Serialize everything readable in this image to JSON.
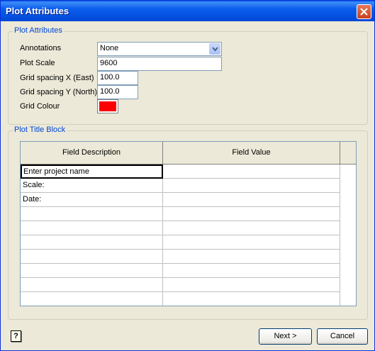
{
  "window": {
    "title": "Plot Attributes"
  },
  "attributes": {
    "group_label": "Plot Attributes",
    "annotations_label": "Annotations",
    "annotations_value": "None",
    "plot_scale_label": "Plot Scale",
    "plot_scale_value": "9600",
    "grid_x_label": "Grid spacing X (East)",
    "grid_x_value": "100.0",
    "grid_y_label": "Grid spacing Y (North)",
    "grid_y_value": "100.0",
    "grid_colour_label": "Grid Colour",
    "grid_colour": "#FF0000"
  },
  "title_block": {
    "group_label": "Plot Title Block",
    "columns": [
      "Field Description",
      "Field Value"
    ],
    "rows": [
      [
        "Enter project name",
        ""
      ],
      [
        "Scale:",
        ""
      ],
      [
        "Date:",
        ""
      ],
      [
        "",
        ""
      ],
      [
        "",
        ""
      ],
      [
        "",
        ""
      ],
      [
        "",
        ""
      ],
      [
        "",
        ""
      ],
      [
        "",
        ""
      ],
      [
        "",
        ""
      ]
    ]
  },
  "buttons": {
    "next": "Next >",
    "cancel": "Cancel"
  },
  "help": {
    "glyph": "?"
  },
  "colors": {
    "titlebar": "#0A5DEC",
    "group_label": "#0046D5",
    "dialog_bg": "#ECE9D8"
  }
}
